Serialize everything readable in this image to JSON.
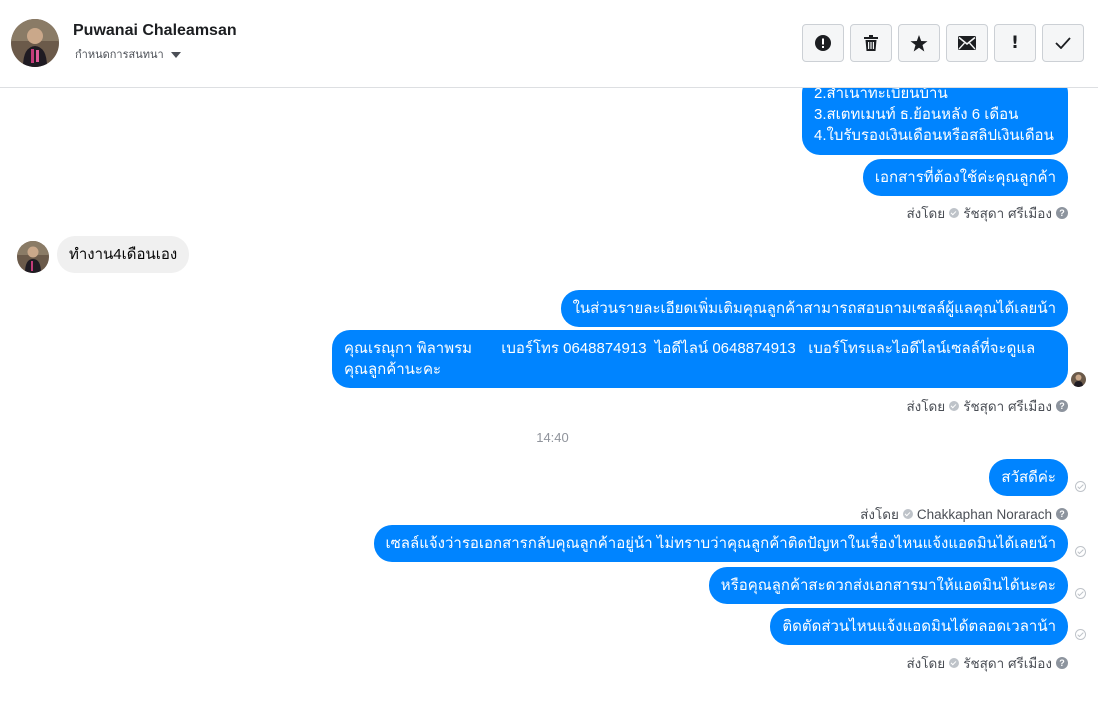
{
  "header": {
    "contact_name": "Puwanai Chaleamsan",
    "subtitle": "กำหนดการสนทนา",
    "actions": [
      {
        "icon": "alert-circle-icon"
      },
      {
        "icon": "trash-icon"
      },
      {
        "icon": "star-icon"
      },
      {
        "icon": "envelope-icon"
      },
      {
        "icon": "exclamation-icon",
        "glyph": "!"
      },
      {
        "icon": "checkmark-icon"
      }
    ]
  },
  "messages": {
    "m1_lines": [
      "2.สำเนาทะเบียนบ้าน",
      "3.สเตทเมนท์ ธ.ย้อนหลัง 6 เดือน",
      "4.ใบรับรองเงินเดือนหรือสลิปเงินเดือน"
    ],
    "m2": "เอกสารที่ต้องใช้ค่ะคุณลูกค้า",
    "sender1": "ส่งโดย",
    "sender1_name": "รัชสุดา ศรีเมือง",
    "in1": "ทำงาน4เดือนเอง",
    "m3": "ในส่วนรายละเอียดเพิ่มเติมคุณลูกค้าสามารถสอบถามเซลล์ผู้แลคุณได้เลยน้า",
    "m4": "คุณเรณุกา พิลาพรม       เบอร์โทร 0648874913  ไอดีไลน์ 0648874913   เบอร์โทรและไอดีไลน์เซลล์ที่จะดูแลคุณลูกค้านะคะ",
    "sender2": "ส่งโดย",
    "sender2_name": "รัชสุดา ศรีเมือง",
    "time": "14:40",
    "m5": "สวัสดีค่ะ",
    "sender3": "ส่งโดย",
    "sender3_name": "Chakkaphan Norarach",
    "m6": "เซลล์แจ้งว่ารอเอกสารกลับคุณลูกค้าอยู่น้า  ไม่ทราบว่าคุณลูกค้าติดปัญหาในเรื่องไหนแจ้งแอดมินได้เลยน้า",
    "m7": "หรือคุณลูกค้าสะดวกส่งเอกสารมาให้แอดมินได้นะคะ",
    "m8": "ติดตัดส่วนไหนแจ้งแอดมินได้ตลอดเวลาน้า",
    "sender4": "ส่งโดย",
    "sender4_name": "รัชสุดา ศรีเมือง",
    "help_glyph": "?"
  },
  "colors": {
    "outgoing_bubble": "#0084ff",
    "incoming_bubble": "#f0f0f0",
    "meta_text": "#4b4f56"
  }
}
